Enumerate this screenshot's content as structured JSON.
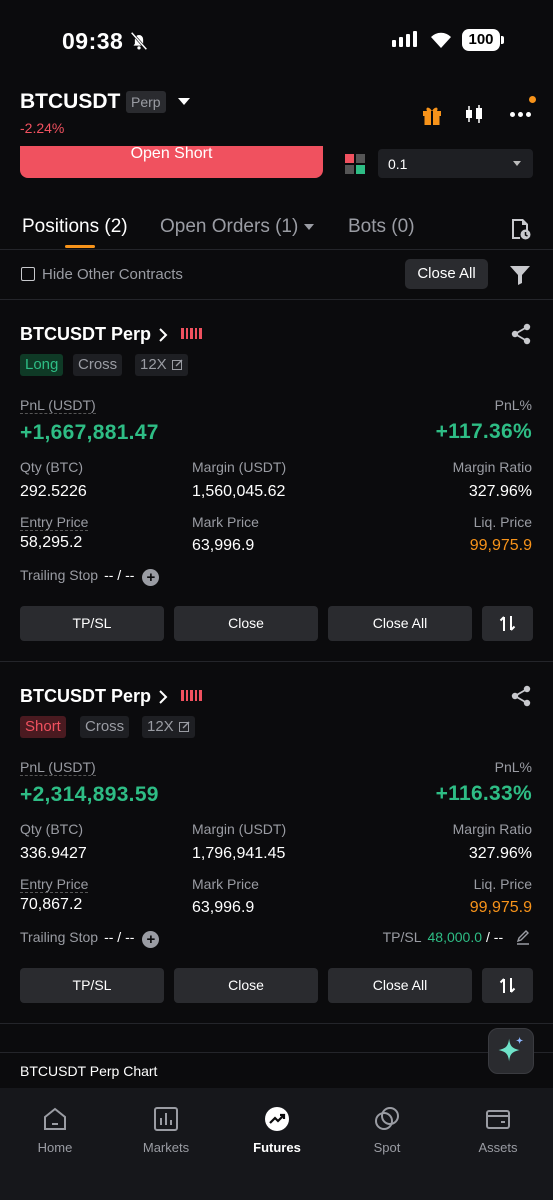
{
  "status_bar": {
    "time": "09:38",
    "battery": "100"
  },
  "header": {
    "symbol": "BTCUSDT",
    "type_badge": "Perp",
    "change": "-2.24%"
  },
  "order_bar": {
    "open_short_label": "Open Short",
    "quantity_value": "0.1"
  },
  "tabs": [
    {
      "label": "Positions (2)",
      "active": true
    },
    {
      "label": "Open Orders (1)",
      "active": false
    },
    {
      "label": "Bots (0)",
      "active": false
    }
  ],
  "filter_row": {
    "hide_label": "Hide Other Contracts",
    "close_all_label": "Close All"
  },
  "positions": [
    {
      "title": "BTCUSDT Perp",
      "side": "Long",
      "margin_mode": "Cross",
      "leverage": "12X",
      "pnl_label": "PnL (USDT)",
      "pnl_value": "+1,667,881.47",
      "pnl_pct_label": "PnL%",
      "pnl_pct_value": "+117.36%",
      "qty_label": "Qty (BTC)",
      "qty_value": "292.5226",
      "margin_label": "Margin (USDT)",
      "margin_value": "1,560,045.62",
      "margin_ratio_label": "Margin Ratio",
      "margin_ratio_value": "327.96%",
      "entry_label": "Entry Price",
      "entry_value": "58,295.2",
      "mark_label": "Mark Price",
      "mark_value": "63,996.9",
      "liq_label": "Liq. Price",
      "liq_value": "99,975.9",
      "trailing_label": "Trailing Stop",
      "trailing_value": "-- / --",
      "buttons": {
        "tpsl": "TP/SL",
        "close": "Close",
        "close_all": "Close All"
      }
    },
    {
      "title": "BTCUSDT Perp",
      "side": "Short",
      "margin_mode": "Cross",
      "leverage": "12X",
      "pnl_label": "PnL (USDT)",
      "pnl_value": "+2,314,893.59",
      "pnl_pct_label": "PnL%",
      "pnl_pct_value": "+116.33%",
      "qty_label": "Qty (BTC)",
      "qty_value": "336.9427",
      "margin_label": "Margin (USDT)",
      "margin_value": "1,796,941.45",
      "margin_ratio_label": "Margin Ratio",
      "margin_ratio_value": "327.96%",
      "entry_label": "Entry Price",
      "entry_value": "70,867.2",
      "mark_label": "Mark Price",
      "mark_value": "63,996.9",
      "liq_label": "Liq. Price",
      "liq_value": "99,975.9",
      "trailing_label": "Trailing Stop",
      "trailing_value": "-- / --",
      "tpsl_label": "TP/SL",
      "tp_value": "48,000.0",
      "sl_value": "/ --",
      "buttons": {
        "tpsl": "TP/SL",
        "close": "Close",
        "close_all": "Close All"
      }
    }
  ],
  "chart_strip": {
    "title": "BTCUSDT Perp Chart"
  },
  "bottom_nav": [
    {
      "label": "Home",
      "icon": "home-icon",
      "active": false
    },
    {
      "label": "Markets",
      "icon": "markets-icon",
      "active": false
    },
    {
      "label": "Futures",
      "icon": "futures-icon",
      "active": true
    },
    {
      "label": "Spot",
      "icon": "spot-icon",
      "active": false
    },
    {
      "label": "Assets",
      "icon": "assets-icon",
      "active": false
    }
  ],
  "colors": {
    "accent": "#f7931a",
    "buy": "#2ebd85",
    "sell": "#f0515f",
    "background": "#0b0b0d"
  }
}
